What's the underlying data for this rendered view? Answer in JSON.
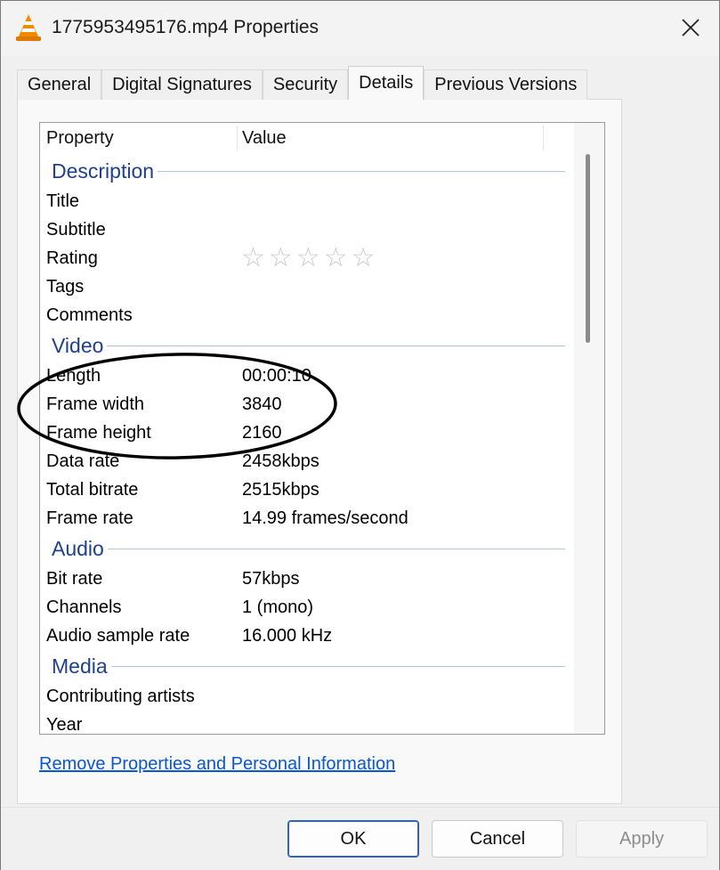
{
  "window": {
    "title": "1775953495176.mp4 Properties"
  },
  "tabs": [
    {
      "label": "General"
    },
    {
      "label": "Digital Signatures"
    },
    {
      "label": "Security"
    },
    {
      "label": "Details",
      "active": true
    },
    {
      "label": "Previous Versions"
    }
  ],
  "list": {
    "header": {
      "property": "Property",
      "value": "Value"
    },
    "groups": {
      "description": {
        "label": "Description",
        "rows": [
          {
            "key": "Title",
            "value": ""
          },
          {
            "key": "Subtitle",
            "value": ""
          },
          {
            "key": "Rating",
            "stars_total": 5,
            "stars_filled": 0
          },
          {
            "key": "Tags",
            "value": ""
          },
          {
            "key": "Comments",
            "value": ""
          }
        ]
      },
      "video": {
        "label": "Video",
        "rows": [
          {
            "key": "Length",
            "value": "00:00:10"
          },
          {
            "key": "Frame width",
            "value": "3840"
          },
          {
            "key": "Frame height",
            "value": "2160"
          },
          {
            "key": "Data rate",
            "value": "2458kbps"
          },
          {
            "key": "Total bitrate",
            "value": "2515kbps"
          },
          {
            "key": "Frame rate",
            "value": "14.99 frames/second"
          }
        ]
      },
      "audio": {
        "label": "Audio",
        "rows": [
          {
            "key": "Bit rate",
            "value": "57kbps"
          },
          {
            "key": "Channels",
            "value": "1 (mono)"
          },
          {
            "key": "Audio sample rate",
            "value": "16.000 kHz"
          }
        ]
      },
      "media": {
        "label": "Media",
        "rows": [
          {
            "key": "Contributing artists",
            "value": ""
          },
          {
            "key": "Year",
            "value": ""
          }
        ]
      }
    }
  },
  "link": {
    "label": "Remove Properties and Personal Information"
  },
  "footer": {
    "ok": "OK",
    "cancel": "Cancel",
    "apply": "Apply"
  },
  "icons": {
    "app": "vlc-cone-icon",
    "close": "close-icon",
    "star": "star-outline-icon"
  },
  "colors": {
    "group_label": "#1f3f8f",
    "link": "#0b57d0",
    "annotation": "#000000"
  }
}
